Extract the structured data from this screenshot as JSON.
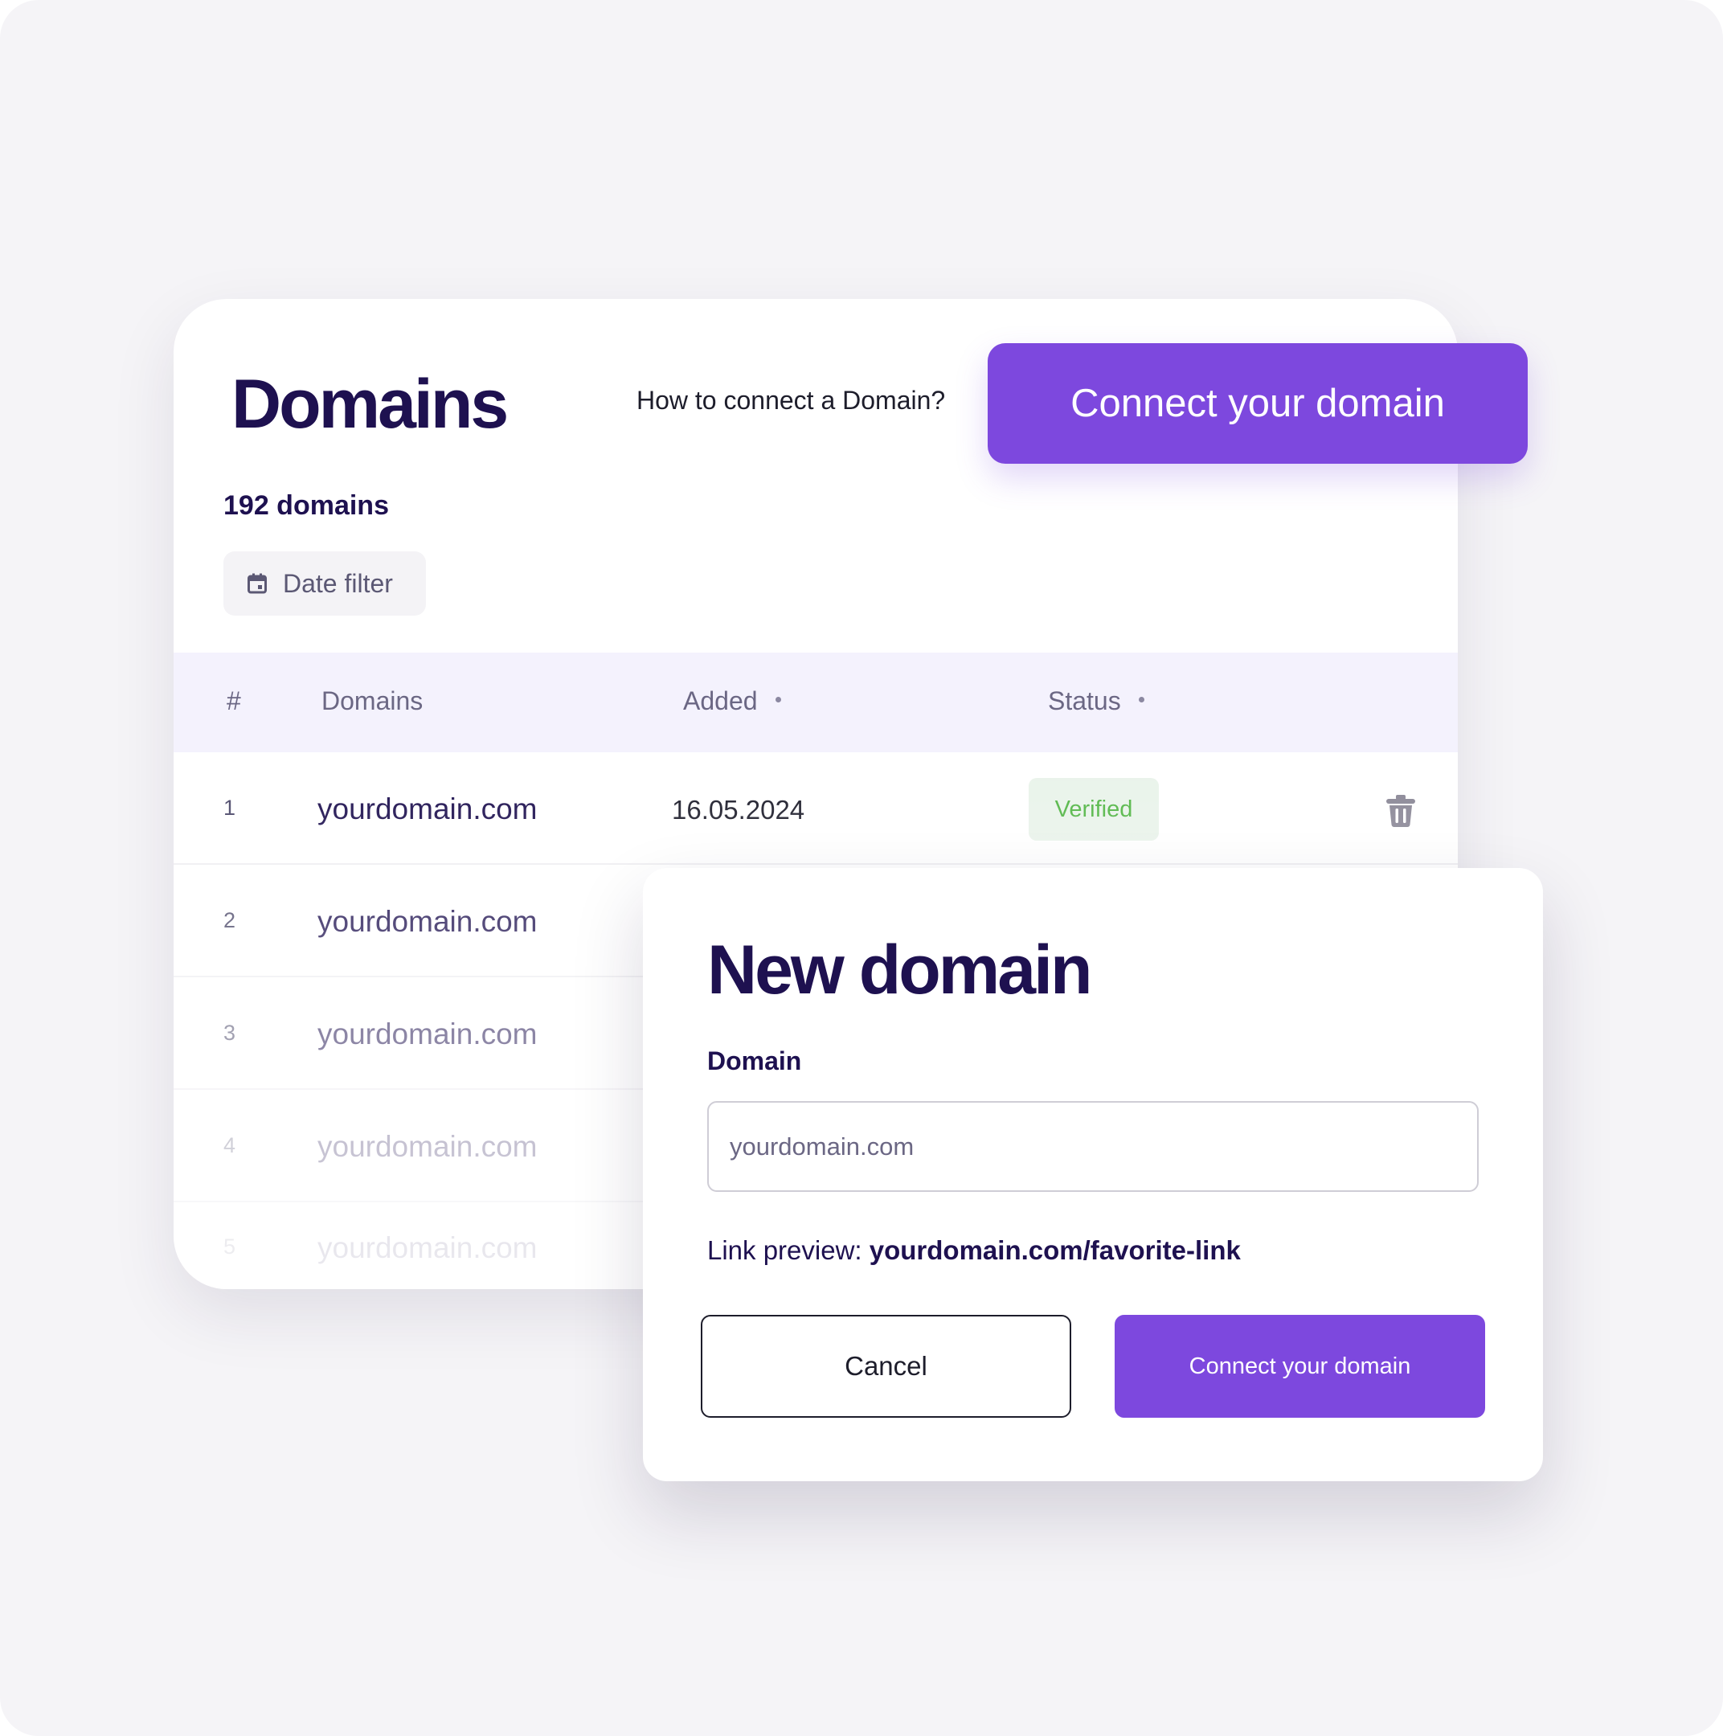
{
  "header": {
    "title": "Domains",
    "help_link": "How to connect a Domain?",
    "cta_label": "Connect your domain"
  },
  "summary": {
    "count_label": "192 domains"
  },
  "filters": {
    "date_filter_label": "Date filter",
    "date_filter_icon": "calendar-icon"
  },
  "table": {
    "columns": [
      "#",
      "Domains",
      "Added",
      "Status"
    ],
    "rows": [
      {
        "num": "1",
        "domain": "yourdomain.com",
        "added": "16.05.2024",
        "status": "Verified"
      },
      {
        "num": "2",
        "domain": "yourdomain.com"
      },
      {
        "num": "3",
        "domain": "yourdomain.com"
      },
      {
        "num": "4",
        "domain": "yourdomain.com"
      },
      {
        "num": "5",
        "domain": "yourdomain.com"
      }
    ],
    "delete_icon": "trash-icon"
  },
  "modal": {
    "title": "New domain",
    "field_label": "Domain",
    "input_placeholder": "yourdomain.com",
    "input_value": "",
    "preview_label": "Link preview:",
    "preview_value": "yourdomain.com/favorite-link",
    "cancel_label": "Cancel",
    "connect_label": "Connect your domain"
  },
  "colors": {
    "accent": "#7d48de",
    "heading": "#1e1150",
    "verified_text": "#53b646",
    "verified_bg": "#e9f3ea",
    "table_header_bg": "#f4f2fd",
    "background": "#f5f4f7"
  }
}
